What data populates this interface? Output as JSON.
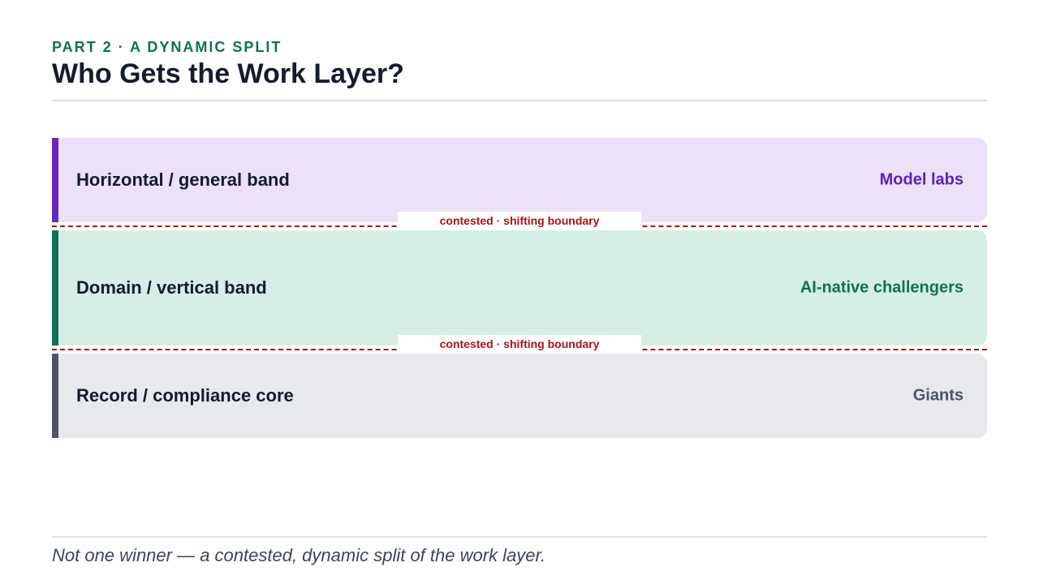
{
  "header": {
    "kicker": "PART 2 · A DYNAMIC SPLIT",
    "title": "Who Gets the Work Layer?"
  },
  "bands": [
    {
      "name": "Horizontal / general band",
      "owner": "Model labs",
      "accent_color": "#6a25c6",
      "fill_color": "#ece1f9"
    },
    {
      "name": "Domain / vertical band",
      "owner": "AI-native challengers",
      "accent_color": "#0e7156",
      "fill_color": "#d5efe7"
    },
    {
      "name": "Record / compliance core",
      "owner": "Giants",
      "accent_color": "#4f5566",
      "fill_color": "#e8e9ec"
    }
  ],
  "boundaries": [
    {
      "label": "contested · shifting boundary",
      "color": "#a3141a"
    },
    {
      "label": "contested · shifting boundary",
      "color": "#a3141a"
    }
  ],
  "footer": {
    "caption": "Not one winner — a contested, dynamic split of the work layer."
  }
}
